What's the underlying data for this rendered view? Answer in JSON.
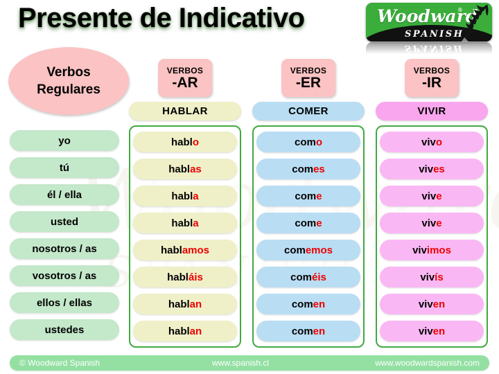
{
  "title": "Presente de Indicativo",
  "logo": {
    "brand": "Woodward",
    "registered": "®",
    "sub": "SPANISH",
    "icon": "fern-leaf-icon"
  },
  "badge_ellipse": {
    "line1": "Verbos",
    "line2": "Regulares"
  },
  "columns": [
    {
      "badge_top": "VERBOS",
      "badge_bottom": "-AR",
      "verb": "HABLAR",
      "stem": "habl",
      "header_color": "#eff0c8",
      "pill_color": "#eff0c8",
      "endings": [
        "o",
        "as",
        "a",
        "a",
        "amos",
        "áis",
        "an",
        "an"
      ],
      "forms": [
        "hablo",
        "hablas",
        "habla",
        "habla",
        "hablamos",
        "habláis",
        "hablan",
        "hablan"
      ]
    },
    {
      "badge_top": "VERBOS",
      "badge_bottom": "-ER",
      "verb": "COMER",
      "stem": "com",
      "header_color": "#b9ddf3",
      "pill_color": "#b9ddf3",
      "endings": [
        "o",
        "es",
        "e",
        "e",
        "emos",
        "éis",
        "en",
        "en"
      ],
      "forms": [
        "como",
        "comes",
        "come",
        "come",
        "comemos",
        "coméis",
        "comen",
        "comen"
      ]
    },
    {
      "badge_top": "VERBOS",
      "badge_bottom": "-IR",
      "verb": "VIVIR",
      "stem": "viv",
      "header_color": "#f9a6ee",
      "pill_color": "#f9b8f3",
      "endings": [
        "o",
        "es",
        "e",
        "e",
        "imos",
        "ís",
        "en",
        "en"
      ],
      "forms": [
        "vivo",
        "vives",
        "vive",
        "vive",
        "vivimos",
        "vivís",
        "viven",
        "viven"
      ]
    }
  ],
  "pronouns": [
    "yo",
    "tú",
    "él / ella",
    "usted",
    "nosotros / as",
    "vosotros / as",
    "ellos / ellas",
    "ustedes"
  ],
  "footer": {
    "copyright": "© Woodward Spanish",
    "url1": "www.spanish.cl",
    "url2": "www.woodwardspanish.com"
  },
  "colors": {
    "ending_red": "#ee0000",
    "box_green": "#41a940",
    "pronoun_green": "#c3e8ca",
    "pink_badge": "#fbc3c3",
    "footer_green": "#93e0a2",
    "logo_green": "#3aad3a"
  },
  "watermark": {
    "line1": "Woodward",
    "line2": "SPANISH"
  }
}
